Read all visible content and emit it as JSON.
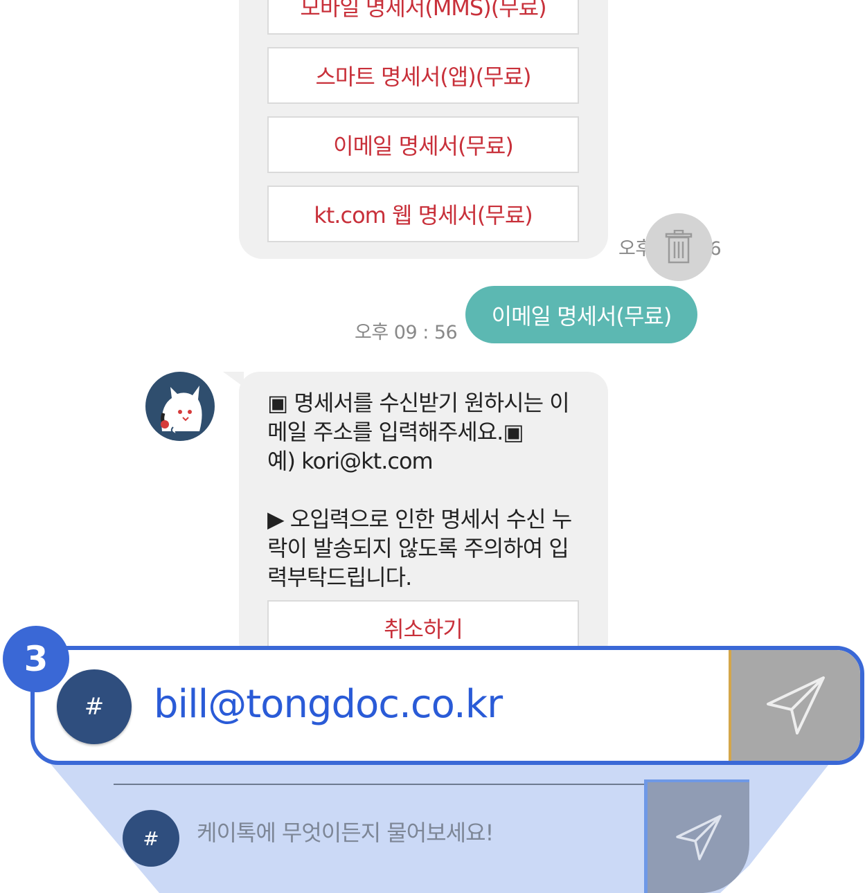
{
  "options": [
    "모바일 명세서(MMS)(무료)",
    "스마트 명세서(앱)(무료)",
    "이메일 명세서(무료)",
    "kt.com 웹 명세서(무료)"
  ],
  "options_time": "오후 09 : 56",
  "user_message": {
    "text": "이메일 명세서(무료)",
    "time": "오후 09 : 56"
  },
  "bot_message": {
    "lines": [
      "▣ 명세서를 수신받기 원하시는 이",
      "메일 주소를 입력해주세요.▣",
      "예) kori@kt.com",
      "",
      "▶ 오입력으로 인한 명세서 수신 누",
      "락이 발송되지 않도록 주의하여 입",
      "력부탁드립니다."
    ],
    "cancel_label": "취소하기"
  },
  "input_bar": {
    "hash_label": "#",
    "placeholder": "케이톡에 무엇이든지 물어보세요!"
  },
  "zoom": {
    "badge": "3",
    "hash_label": "#",
    "typed_value": "bill@tongdoc.co.kr"
  },
  "icons": {
    "trash": "trash-icon",
    "send": "send-icon"
  },
  "colors": {
    "accent_red": "#c8303a",
    "user_bubble": "#5cb8b2",
    "highlight_blue": "#3a68d6"
  }
}
